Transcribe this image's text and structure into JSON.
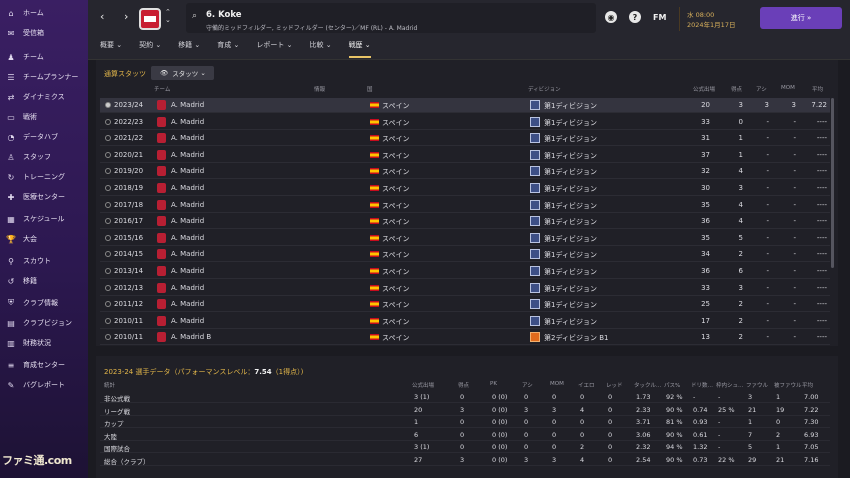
{
  "sidebar": {
    "items": [
      {
        "label": "ホーム",
        "icon": "home-icon"
      },
      {
        "label": "受信箱",
        "icon": "inbox-icon"
      },
      {
        "label": "チーム",
        "icon": "team-icon"
      },
      {
        "label": "チームプランナー",
        "icon": "planner-icon"
      },
      {
        "label": "ダイナミクス",
        "icon": "dynamics-icon"
      },
      {
        "label": "戦術",
        "icon": "tactics-icon"
      },
      {
        "label": "データハブ",
        "icon": "data-hub-icon"
      },
      {
        "label": "スタッフ",
        "icon": "staff-icon"
      },
      {
        "label": "トレーニング",
        "icon": "training-icon"
      },
      {
        "label": "医療センター",
        "icon": "medical-icon"
      },
      {
        "label": "スケジュール",
        "icon": "calendar-icon"
      },
      {
        "label": "大会",
        "icon": "trophy-icon"
      },
      {
        "label": "スカウト",
        "icon": "scout-icon"
      },
      {
        "label": "移籍",
        "icon": "transfer-icon"
      },
      {
        "label": "クラブ情報",
        "icon": "club-info-icon"
      },
      {
        "label": "クラブビジョン",
        "icon": "club-vision-icon"
      },
      {
        "label": "財務状況",
        "icon": "finance-icon"
      },
      {
        "label": "育成センター",
        "icon": "development-icon"
      },
      {
        "label": "バグレポート",
        "icon": "bug-icon"
      }
    ]
  },
  "player": {
    "name": "6. Koke",
    "position": "守備的ミッドフィルダー, ミッドフィルダー (センター)／MF (RL) - A. Madrid"
  },
  "header": {
    "time": "水 08:00",
    "date": "2024年1月17日",
    "logo": "FM",
    "continue_label": "進行"
  },
  "tabs": [
    "概要",
    "契約",
    "移籍",
    "育成",
    "レポート",
    "比較",
    "戦歴"
  ],
  "panel": {
    "title": "通算スタッツ",
    "dropdown": "スタッツ"
  },
  "career_headers": {
    "team": "チーム",
    "info": "情報",
    "nation": "国",
    "division": "ディビジョン",
    "apps": "公式出場",
    "goals": "得点",
    "assists": "アシ",
    "mom": "MOM",
    "avg": "平均"
  },
  "career_rows": [
    {
      "season": "2023/24",
      "team": "A. Madrid",
      "nation": "スペイン",
      "division": "第1ディビジョン",
      "apps": "20",
      "goals": "3",
      "assists": "3",
      "mom": "3",
      "avg": "7.22"
    },
    {
      "season": "2022/23",
      "team": "A. Madrid",
      "nation": "スペイン",
      "division": "第1ディビジョン",
      "apps": "33",
      "goals": "0",
      "assists": "-",
      "mom": "-",
      "avg": "----"
    },
    {
      "season": "2021/22",
      "team": "A. Madrid",
      "nation": "スペイン",
      "division": "第1ディビジョン",
      "apps": "31",
      "goals": "1",
      "assists": "-",
      "mom": "-",
      "avg": "----"
    },
    {
      "season": "2020/21",
      "team": "A. Madrid",
      "nation": "スペイン",
      "division": "第1ディビジョン",
      "apps": "37",
      "goals": "1",
      "assists": "-",
      "mom": "-",
      "avg": "----"
    },
    {
      "season": "2019/20",
      "team": "A. Madrid",
      "nation": "スペイン",
      "division": "第1ディビジョン",
      "apps": "32",
      "goals": "4",
      "assists": "-",
      "mom": "-",
      "avg": "----"
    },
    {
      "season": "2018/19",
      "team": "A. Madrid",
      "nation": "スペイン",
      "division": "第1ディビジョン",
      "apps": "30",
      "goals": "3",
      "assists": "-",
      "mom": "-",
      "avg": "----"
    },
    {
      "season": "2017/18",
      "team": "A. Madrid",
      "nation": "スペイン",
      "division": "第1ディビジョン",
      "apps": "35",
      "goals": "4",
      "assists": "-",
      "mom": "-",
      "avg": "----"
    },
    {
      "season": "2016/17",
      "team": "A. Madrid",
      "nation": "スペイン",
      "division": "第1ディビジョン",
      "apps": "36",
      "goals": "4",
      "assists": "-",
      "mom": "-",
      "avg": "----"
    },
    {
      "season": "2015/16",
      "team": "A. Madrid",
      "nation": "スペイン",
      "division": "第1ディビジョン",
      "apps": "35",
      "goals": "5",
      "assists": "-",
      "mom": "-",
      "avg": "----"
    },
    {
      "season": "2014/15",
      "team": "A. Madrid",
      "nation": "スペイン",
      "division": "第1ディビジョン",
      "apps": "34",
      "goals": "2",
      "assists": "-",
      "mom": "-",
      "avg": "----"
    },
    {
      "season": "2013/14",
      "team": "A. Madrid",
      "nation": "スペイン",
      "division": "第1ディビジョン",
      "apps": "36",
      "goals": "6",
      "assists": "-",
      "mom": "-",
      "avg": "----"
    },
    {
      "season": "2012/13",
      "team": "A. Madrid",
      "nation": "スペイン",
      "division": "第1ディビジョン",
      "apps": "33",
      "goals": "3",
      "assists": "-",
      "mom": "-",
      "avg": "----"
    },
    {
      "season": "2011/12",
      "team": "A. Madrid",
      "nation": "スペイン",
      "division": "第1ディビジョン",
      "apps": "25",
      "goals": "2",
      "assists": "-",
      "mom": "-",
      "avg": "----"
    },
    {
      "season": "2010/11",
      "team": "A. Madrid",
      "nation": "スペイン",
      "division": "第1ディビジョン",
      "apps": "17",
      "goals": "2",
      "assists": "-",
      "mom": "-",
      "avg": "----"
    },
    {
      "season": "2010/11",
      "team": "A. Madrid B",
      "nation": "スペイン",
      "division": "第2ディビジョン B1",
      "apps": "13",
      "goals": "2",
      "assists": "-",
      "mom": "-",
      "avg": "----"
    }
  ],
  "season_panel": {
    "title": "2023-24 選手データ（パフォーマンスレベル：",
    "level": "7.54",
    "level_suffix": "（1得点）)",
    "headers": [
      "統計",
      "公式出場",
      "得点",
      "PK",
      "アシ",
      "MOM",
      "イエロ",
      "レッド",
      "タックル…",
      "パス%",
      "ドリ数…",
      "枠内シュ…",
      "ファウル",
      "被ファウル",
      "平均"
    ],
    "rows": [
      [
        "非公式戦",
        "3 (1)",
        "0",
        "0 (0)",
        "0",
        "0",
        "0",
        "0",
        "1.73",
        "92 %",
        "-",
        "-",
        "3",
        "1",
        "7.00"
      ],
      [
        "リーグ戦",
        "20",
        "3",
        "0 (0)",
        "3",
        "3",
        "4",
        "0",
        "2.33",
        "90 %",
        "0.74",
        "25 %",
        "21",
        "19",
        "7.22"
      ],
      [
        "カップ",
        "1",
        "0",
        "0 (0)",
        "0",
        "0",
        "0",
        "0",
        "3.71",
        "81 %",
        "0.93",
        "-",
        "1",
        "0",
        "7.30"
      ],
      [
        "大陸",
        "6",
        "0",
        "0 (0)",
        "0",
        "0",
        "0",
        "0",
        "3.06",
        "90 %",
        "0.61",
        "-",
        "7",
        "2",
        "6.93"
      ],
      [
        "国際試合",
        "3 (1)",
        "0",
        "0 (0)",
        "0",
        "0",
        "2",
        "0",
        "2.32",
        "94 %",
        "1.32",
        "-",
        "5",
        "1",
        "7.05"
      ],
      [
        "総合（クラブ）",
        "27",
        "3",
        "0 (0)",
        "3",
        "3",
        "4",
        "0",
        "2.54",
        "90 %",
        "0.73",
        "22 %",
        "29",
        "21",
        "7.16"
      ]
    ]
  },
  "watermark": "ファミ通.com"
}
